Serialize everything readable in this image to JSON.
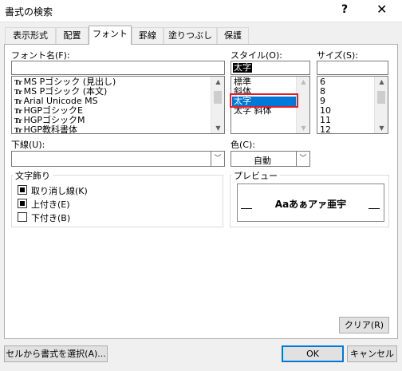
{
  "window": {
    "title": "書式の検索",
    "help": "?",
    "close": "✕"
  },
  "tabs": [
    "表示形式",
    "配置",
    "フォント",
    "罫線",
    "塗りつぶし",
    "保護"
  ],
  "font_name": {
    "label": "フォント名(F):",
    "value": "",
    "items": [
      "MS Pゴシック (見出し)",
      "MS Pゴシック (本文)",
      "Arial Unicode MS",
      "HGPゴシックE",
      "HGPゴシックM",
      "HGP教科書体"
    ]
  },
  "style": {
    "label": "スタイル(O):",
    "value": "太字",
    "items": [
      "標準",
      "斜体",
      "太字",
      "太字 斜体"
    ]
  },
  "size": {
    "label": "サイズ(S):",
    "value": "",
    "items": [
      "6",
      "8",
      "9",
      "10",
      "11",
      "12"
    ]
  },
  "underline": {
    "label": "下線(U):",
    "value": ""
  },
  "color": {
    "label": "色(C):",
    "value": "自動"
  },
  "effects": {
    "title": "文字飾り",
    "strikethrough": "取り消し線(K)",
    "superscript": "上付き(E)",
    "subscript": "下付き(B)"
  },
  "preview": {
    "title": "プレビュー",
    "sample": "Aaあぁアァ亜宇"
  },
  "buttons": {
    "clear": "クリア(R)",
    "choose_from_cell": "セルから書式を選択(A)...",
    "ok": "OK",
    "cancel": "キャンセル"
  }
}
